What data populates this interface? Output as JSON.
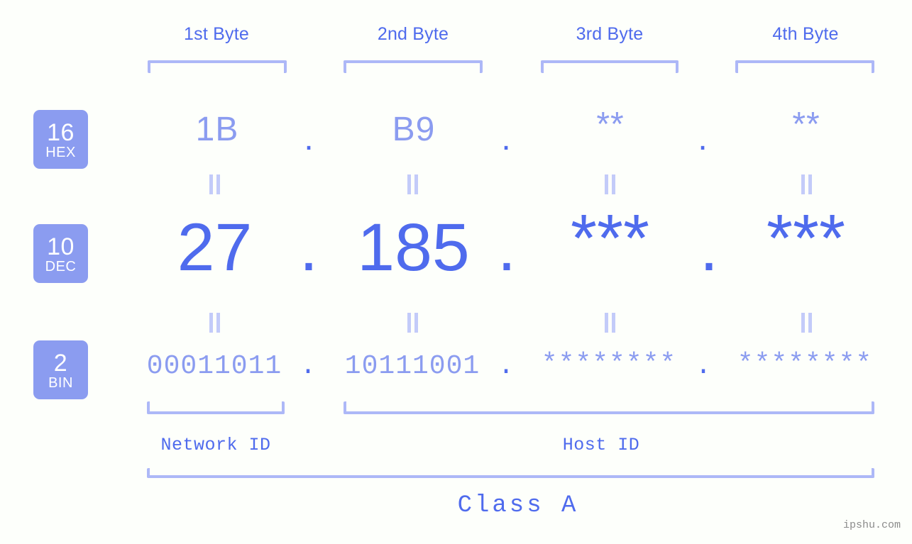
{
  "page": {
    "background_color": "#fdfffb",
    "accent_strong": "#4f6bed",
    "accent_light": "#8b9cf0",
    "bracket_color": "#adb8f7",
    "watermark": "ipshu.com"
  },
  "byte_headers": [
    {
      "label": "1st Byte"
    },
    {
      "label": "2nd Byte"
    },
    {
      "label": "3rd Byte"
    },
    {
      "label": "4th Byte"
    }
  ],
  "bases": [
    {
      "number": "16",
      "name": "HEX"
    },
    {
      "number": "10",
      "name": "DEC"
    },
    {
      "number": "2",
      "name": "BIN"
    }
  ],
  "rows": {
    "hex": {
      "base_number": "16",
      "base_name": "HEX",
      "values": [
        "1B",
        "B9",
        "**",
        "**"
      ],
      "separators": [
        ".",
        ".",
        "."
      ]
    },
    "dec": {
      "base_number": "10",
      "base_name": "DEC",
      "values": [
        "27",
        "185",
        "***",
        "***"
      ],
      "separators": [
        ".",
        ".",
        "."
      ]
    },
    "bin": {
      "base_number": "2",
      "base_name": "BIN",
      "values": [
        "00011011",
        "10111001",
        "********",
        "********"
      ],
      "separators": [
        ".",
        ".",
        "."
      ]
    }
  },
  "equals_symbols": {
    "glyph": "||",
    "count_per_gap": 4,
    "gaps": 2
  },
  "segments": {
    "network_id": "Network ID",
    "host_id": "Host ID",
    "class": "Class A"
  }
}
